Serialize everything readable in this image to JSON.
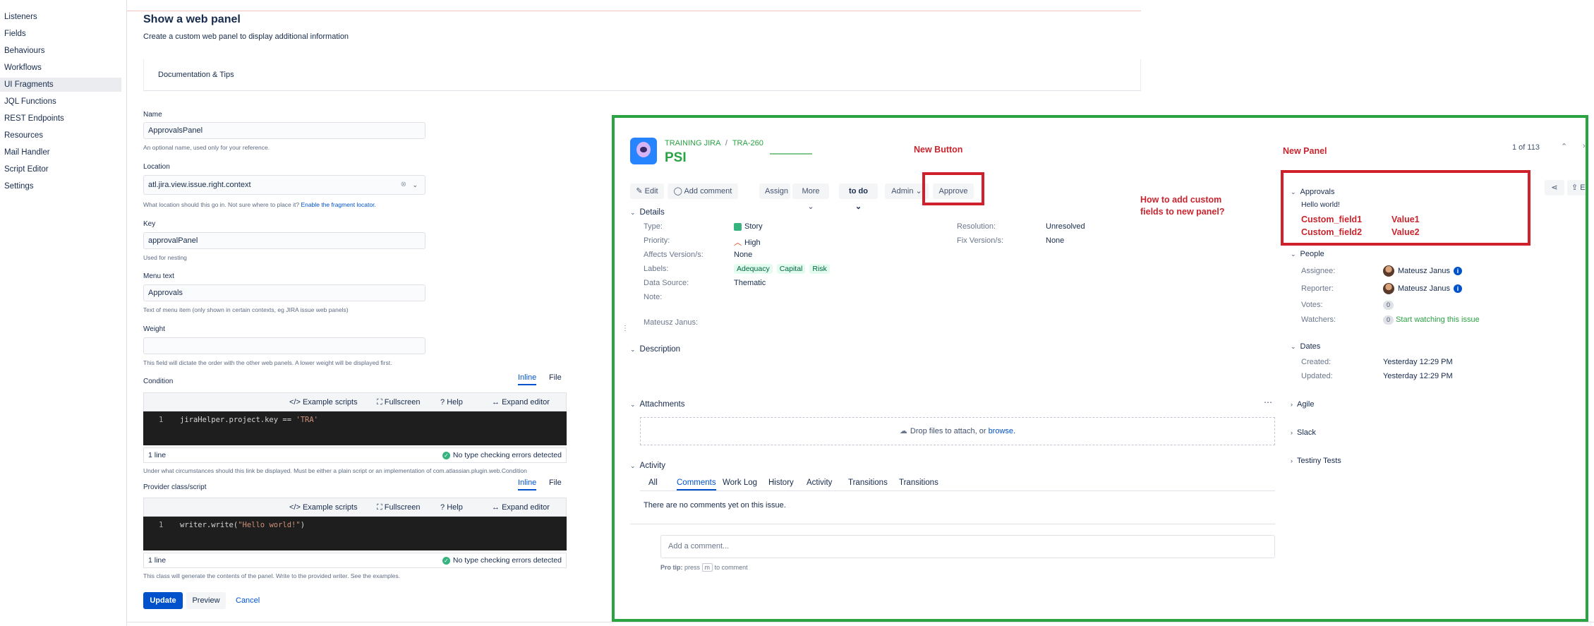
{
  "left_nav": {
    "items": [
      {
        "label": "Listeners",
        "active": false
      },
      {
        "label": "Fields",
        "active": false
      },
      {
        "label": "Behaviours",
        "active": false
      },
      {
        "label": "Workflows",
        "active": false
      },
      {
        "label": "UI Fragments",
        "active": true
      },
      {
        "label": "JQL Functions",
        "active": false
      },
      {
        "label": "REST Endpoints",
        "active": false
      },
      {
        "label": "Resources",
        "active": false
      },
      {
        "label": "Mail Handler",
        "active": false
      },
      {
        "label": "Script Editor",
        "active": false
      },
      {
        "label": "Settings",
        "active": false
      }
    ]
  },
  "form": {
    "title": "Show a web panel",
    "subtitle": "Create a custom web panel to display additional information",
    "doc_tips": "Documentation & Tips",
    "name": {
      "label": "Name",
      "value": "ApprovalsPanel",
      "help": "An optional name, used only for your reference."
    },
    "location": {
      "label": "Location",
      "value": "atl.jira.view.issue.right.context",
      "help": "What location should this go in. Not sure where to place it?",
      "help_link": "Enable the fragment locator."
    },
    "key": {
      "label": "Key",
      "value": "approvalPanel",
      "help": "Used for nesting"
    },
    "menu_text": {
      "label": "Menu text",
      "value": "Approvals",
      "help": "Text of menu item (only shown in certain contexts, eg JIRA issue web panels)"
    },
    "weight": {
      "label": "Weight",
      "value": "",
      "help": "This field will dictate the order with the other web panels. A lower weight will be displayed first."
    },
    "condition": {
      "label": "Condition",
      "tabs": [
        "Inline",
        "File"
      ],
      "toolbar": [
        "Example scripts",
        "Fullscreen",
        "Help",
        "Expand editor"
      ],
      "line_no": "1",
      "code_plain": "jiraHelper.project.key == ",
      "code_str": "'TRA'",
      "lines": "1 line",
      "status": "No type checking errors detected",
      "help": "Under what circumstances should this link be displayed. Must be either a plain script or an implementation of com.atlassian.plugin.web.Condition"
    },
    "provider": {
      "label": "Provider class/script",
      "tabs": [
        "Inline",
        "File"
      ],
      "toolbar": [
        "Example scripts",
        "Fullscreen",
        "Help",
        "Expand editor"
      ],
      "line_no": "1",
      "code_plain": "writer.write(",
      "code_str": "\"Hello world!\"",
      "code_end": ")",
      "lines": "1 line",
      "status": "No type checking errors detected",
      "help": "This class will generate the contents of the panel. Write to the provided writer. See the examples."
    },
    "buttons": {
      "update": "Update",
      "preview": "Preview",
      "cancel": "Cancel"
    }
  },
  "issue": {
    "project": "TRAINING JIRA",
    "sep": "/",
    "issue_key": "TRA-260",
    "summary_visible": "PSI",
    "counter": "1 of 113",
    "toolbar": {
      "edit": "Edit",
      "add_comment": "Add comment",
      "assign": "Assign",
      "more": "More",
      "status": "to do",
      "admin": "Admin",
      "approve": "Approve"
    },
    "details": {
      "header": "Details",
      "left": [
        {
          "label": "Type:",
          "value": "Story"
        },
        {
          "label": "Priority:",
          "value": "High"
        },
        {
          "label": "Affects Version/s:",
          "value": "None"
        },
        {
          "label": "Labels:",
          "value": ""
        },
        {
          "label": "Data Source:",
          "value": "Thematic"
        },
        {
          "label": "Note:",
          "value": ""
        },
        {
          "label": "Mateusz Janus:",
          "value": ""
        }
      ],
      "labels": [
        "Adequacy",
        "Capital",
        "Risk"
      ],
      "right": [
        {
          "label": "Resolution:",
          "value": "Unresolved"
        },
        {
          "label": "Fix Version/s:",
          "value": "None"
        }
      ]
    },
    "description": "Description",
    "attachments": {
      "header": "Attachments",
      "drop_text": "Drop files to attach, or",
      "browse": "browse."
    },
    "activity": {
      "header": "Activity",
      "tabs": [
        "All",
        "Comments",
        "Work Log",
        "History",
        "Activity",
        "Transitions",
        "Transitions"
      ],
      "active_tab": "Comments",
      "empty": "There are no comments yet on this issue.",
      "comment_placeholder": "Add a comment...",
      "protip_label": "Pro tip:",
      "protip_press": "press",
      "protip_key": "m",
      "protip_rest": "to comment"
    },
    "side": {
      "approvals": {
        "header": "Approvals",
        "body": "Hello world!"
      },
      "people": {
        "header": "People",
        "assignee_label": "Assignee:",
        "assignee": "Mateusz Janus",
        "reporter_label": "Reporter:",
        "reporter": "Mateusz Janus",
        "votes_label": "Votes:",
        "votes": "0",
        "watchers_label": "Watchers:",
        "watchers": "0",
        "watch_link": "Start watching this issue"
      },
      "dates": {
        "header": "Dates",
        "created_label": "Created:",
        "created": "Yesterday 12:29 PM",
        "updated_label": "Updated:",
        "updated": "Yesterday 12:29 PM"
      },
      "agile": "Agile",
      "slack": "Slack",
      "testiny": "Testiny Tests"
    },
    "export_label": "E"
  },
  "annotations": {
    "new_button": "New Button",
    "new_panel": "New Panel",
    "question_line1": "How to add custom",
    "question_line2": "fields to new panel?",
    "custom_field1": "Custom_field1",
    "value1": "Value1",
    "custom_field2": "Custom_field2",
    "value2": "Value2"
  },
  "colors": {
    "green_frame": "#2aa343",
    "red_annotation": "#d0202c",
    "primary": "#0052cc"
  }
}
